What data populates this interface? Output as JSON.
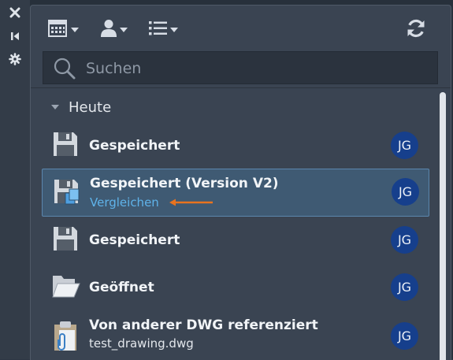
{
  "side_strip": {
    "close_icon": "close-icon",
    "collapse_icon": "collapse-panel-icon",
    "settings_icon": "settings-icon"
  },
  "toolbar": {
    "calendar_filter_icon": "calendar-icon",
    "user_filter_icon": "user-icon",
    "list_filter_icon": "list-icon",
    "refresh_icon": "refresh-icon"
  },
  "search": {
    "placeholder": "Suchen",
    "value": ""
  },
  "group": {
    "label": "Heute",
    "expanded": true
  },
  "items": [
    {
      "icon": "floppy-disk-icon",
      "title": "Gespeichert",
      "subtitle": "",
      "link": "",
      "user_initials": "JG",
      "selected": false
    },
    {
      "icon": "floppy-disk-version-icon",
      "title": "Gespeichert (Version V2)",
      "subtitle": "",
      "link": "Vergleichen",
      "user_initials": "JG",
      "selected": true
    },
    {
      "icon": "floppy-disk-icon",
      "title": "Gespeichert",
      "subtitle": "",
      "link": "",
      "user_initials": "JG",
      "selected": false
    },
    {
      "icon": "open-folder-icon",
      "title": "Geöffnet",
      "subtitle": "",
      "link": "",
      "user_initials": "JG",
      "selected": false
    },
    {
      "icon": "clipboard-reference-icon",
      "title": "Von anderer DWG referenziert",
      "subtitle": "test_drawing.dwg",
      "link": "",
      "user_initials": "JG",
      "selected": false
    }
  ],
  "colors": {
    "panel_bg": "#3a4452",
    "selected_bg": "#3f5a73",
    "selected_border": "#5b86ad",
    "link": "#5fb3ea",
    "avatar_bg": "#163f8c",
    "annotation_arrow": "#e8731f"
  }
}
